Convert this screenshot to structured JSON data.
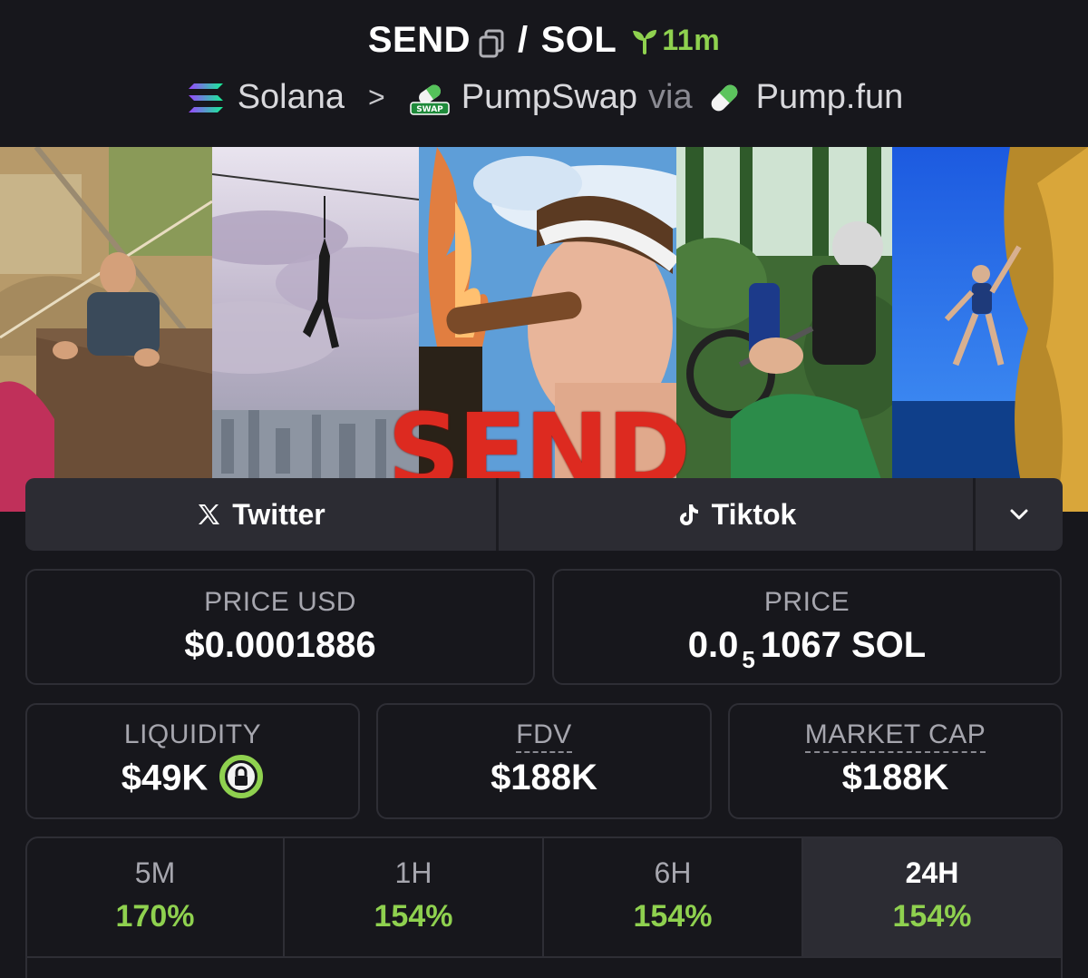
{
  "header": {
    "base_token": "SEND",
    "separator": "/",
    "quote_token": "SOL",
    "age": "11m",
    "chain": "Solana",
    "dex": "PumpSwap",
    "via": "via",
    "launchpad": "Pump.fun",
    "dex_badge": "SWAP"
  },
  "banner": {
    "overlay_text": "SEND IT"
  },
  "socials": {
    "twitter_label": "Twitter",
    "tiktok_label": "Tiktok"
  },
  "stats": {
    "price_usd_label": "PRICE USD",
    "price_usd_value": "$0.0001886",
    "price_label": "PRICE",
    "price_prefix": "0.0",
    "price_zero_count": "5",
    "price_suffix": "1067 SOL",
    "liquidity_label": "LIQUIDITY",
    "liquidity_value": "$49K",
    "fdv_label": "FDV",
    "fdv_value": "$188K",
    "market_cap_label": "MARKET CAP",
    "market_cap_value": "$188K"
  },
  "timeframes": [
    {
      "label": "5M",
      "value": "170%"
    },
    {
      "label": "1H",
      "value": "154%"
    },
    {
      "label": "6H",
      "value": "154%"
    },
    {
      "label": "24H",
      "value": "154%"
    }
  ],
  "colors": {
    "background": "#17171c",
    "positive": "#8fd14f",
    "card_border": "#2e2e35",
    "button_bg": "#2c2c33"
  }
}
